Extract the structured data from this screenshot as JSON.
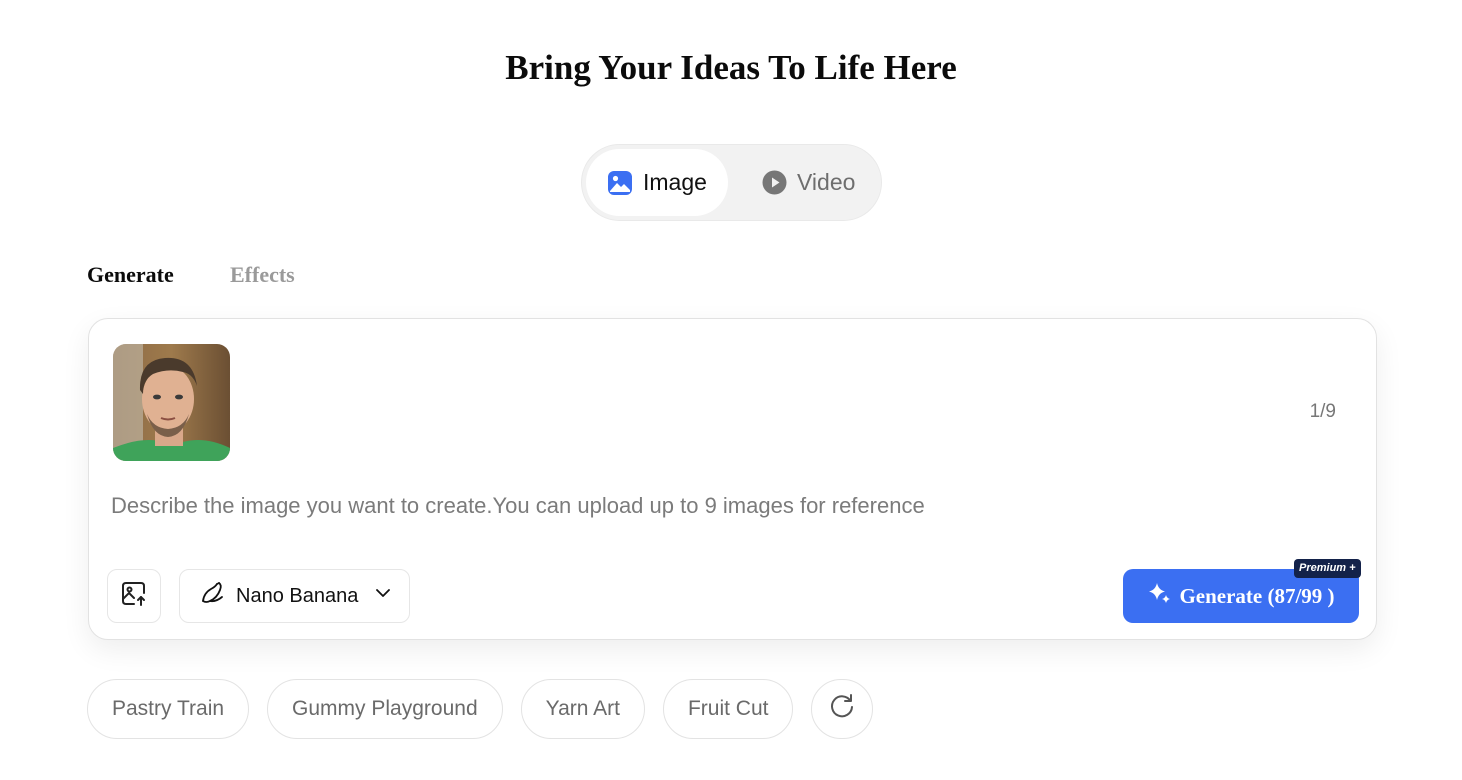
{
  "page": {
    "title": "Bring Your Ideas To Life Here"
  },
  "mode_switch": {
    "image_label": "Image",
    "video_label": "Video",
    "active": "Image"
  },
  "tabs": {
    "generate": "Generate",
    "effects": "Effects",
    "active": "Generate"
  },
  "composer": {
    "image_counter": "1/9",
    "prompt_placeholder": "Describe the image you want to create.You can upload up to 9 images for reference",
    "prompt_value": "",
    "model_label": "Nano Banana",
    "generate_label": "Generate (87/99 )",
    "premium_badge": "Premium +"
  },
  "suggestions": [
    {
      "label": "Pastry Train"
    },
    {
      "label": "Gummy Playground"
    },
    {
      "label": "Yarn Art"
    },
    {
      "label": "Fruit Cut"
    }
  ],
  "icons": {
    "image_mode": "image-icon",
    "video_mode": "play-circle-icon",
    "upload": "image-upload-icon",
    "model": "banana-icon",
    "dropdown": "chevron-down-icon",
    "generate": "sparkle-icon",
    "refresh": "refresh-icon"
  },
  "colors": {
    "accent": "#3b6ff2",
    "badge": "#13224a",
    "muted_text": "#7b7b7b"
  }
}
